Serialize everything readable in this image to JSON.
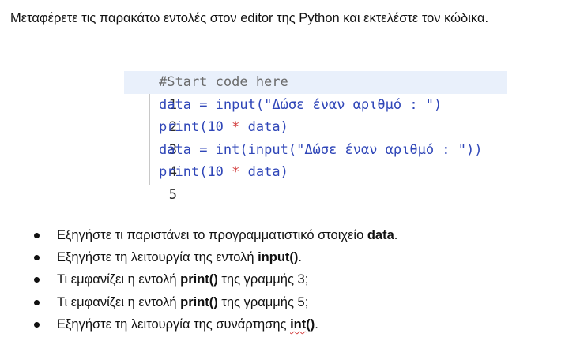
{
  "intro": "Μεταφέρετε τις παρακάτω  εντολές στον editor της Python και εκτελέστε τον κώδικα.",
  "code": {
    "lines": [
      {
        "no": "1",
        "comment": "#Start code here"
      },
      {
        "no": "2",
        "var": "data",
        "eq": " = ",
        "fn": "input",
        "open": "(",
        "str": "\"Δώσε έναν αριθμό : \"",
        "close": ")"
      },
      {
        "no": "3",
        "fn": "print",
        "open": "(",
        "num": "10",
        "star": " * ",
        "var": "data",
        "close": ")"
      },
      {
        "no": "4",
        "var": "data",
        "eq": " = ",
        "fn": "int",
        "open": "(",
        "fn2": "input",
        "open2": "(",
        "str": "\"Δώσε έναν αριθμό : \"",
        "close": "))"
      },
      {
        "no": "5",
        "fn": "print",
        "open": "(",
        "num": "10",
        "star": " * ",
        "var": "data",
        "close": ")"
      }
    ]
  },
  "bullets": [
    {
      "pre": "Εξηγήστε τι παριστάνει το προγραμματιστικό στοιχείο ",
      "bold": "data",
      "post": "."
    },
    {
      "pre": "Εξηγήστε τη λειτουργία της εντολή ",
      "bold": "input()",
      "post": "."
    },
    {
      "pre": "Τι εμφανίζει η εντολή ",
      "bold": "print()",
      "post": " της γραμμής 3;"
    },
    {
      "pre": "Τι εμφανίζει η εντολή ",
      "bold": "print()",
      "post": " της γραμμής 5;"
    },
    {
      "pre": "Εξηγήστε τη λειτουργία της συνάρτησης ",
      "bold_a": "int",
      "bold": "()",
      "post": "."
    }
  ]
}
